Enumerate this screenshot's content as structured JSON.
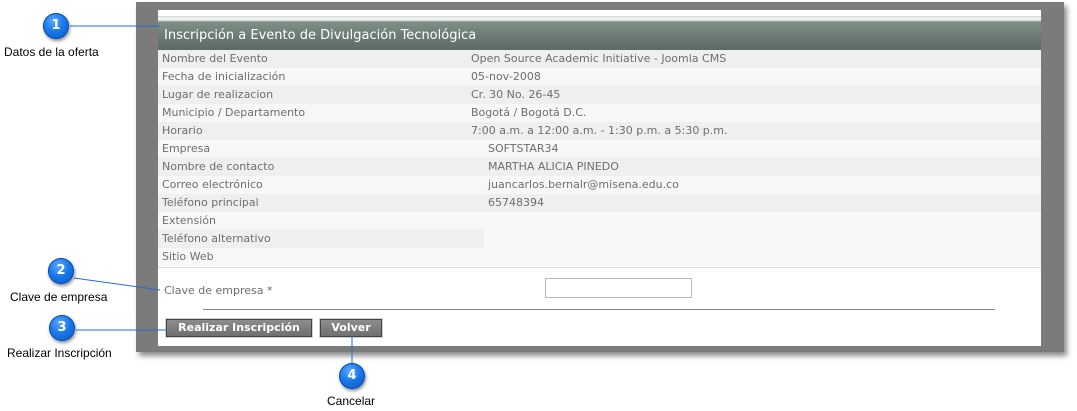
{
  "header": {
    "title": "Inscripción a Evento de Divulgación Tecnológica"
  },
  "fields": [
    {
      "label": "Nombre del Evento",
      "value": "Open Source Academic Initiative - Joomla CMS"
    },
    {
      "label": "Fecha de inicialización",
      "value": "05-nov-2008"
    },
    {
      "label": "Lugar de realizacion",
      "value": "Cr. 30 No. 26-45"
    },
    {
      "label": "Municipio / Departamento",
      "value": "Bogotá / Bogotá D.C."
    },
    {
      "label": "Horario",
      "value": "7:00 a.m. a 12:00 a.m. - 1:30 p.m. a 5:30 p.m."
    },
    {
      "label": "Empresa",
      "value": "SOFTSTAR34"
    },
    {
      "label": "Nombre de contacto",
      "value": "MARTHA ALICIA PINEDO"
    },
    {
      "label": "Correo electrónico",
      "value": "juancarlos.bernalr@misena.edu.co"
    },
    {
      "label": "Teléfono principal",
      "value": "65748394"
    },
    {
      "label": "Extensión",
      "value": ""
    },
    {
      "label": "Teléfono alternativo",
      "value": ""
    },
    {
      "label": "Sitio Web",
      "value": ""
    }
  ],
  "form": {
    "clave_label": "Clave de empresa *",
    "clave_value": ""
  },
  "buttons": {
    "realizar": "Realizar Inscripción",
    "volver": "Volver"
  },
  "callouts": [
    {
      "number": "1",
      "label": "Datos de la oferta"
    },
    {
      "number": "2",
      "label": "Clave de empresa"
    },
    {
      "number": "3",
      "label": "Realizar Inscripción"
    },
    {
      "number": "4",
      "label": "Cancelar"
    }
  ],
  "colors": {
    "callout": "#1877e8",
    "header": "#5b6b63",
    "frame": "#7b7b7b"
  }
}
